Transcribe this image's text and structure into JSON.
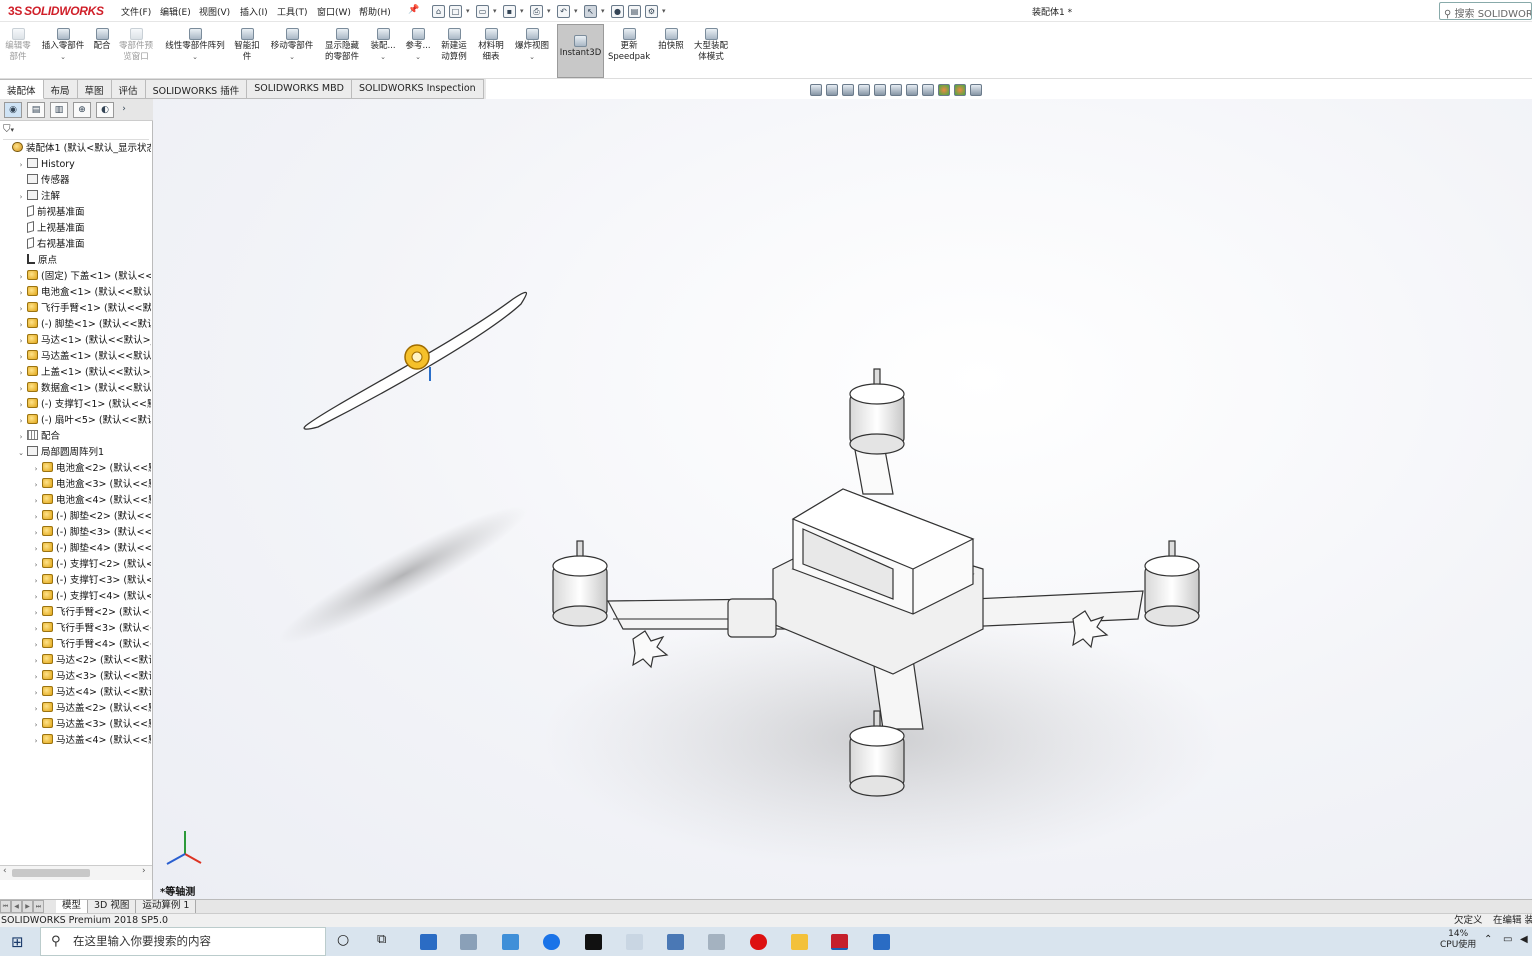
{
  "app": {
    "brand": "SOLIDWORKS",
    "doc_title": "装配体1 *",
    "search_placeholder": "搜索 SOLIDWORKS"
  },
  "menu": [
    "文件(F)",
    "编辑(E)",
    "视图(V)",
    "插入(I)",
    "工具(T)",
    "窗口(W)",
    "帮助(H)"
  ],
  "commands": [
    {
      "label": "编辑零\n部件",
      "disabled": true
    },
    {
      "label": "插入零部件",
      "dropdown": true
    },
    {
      "label": "配合"
    },
    {
      "label": "零部件预\n览窗口",
      "disabled": true
    },
    {
      "label": "线性零部件阵列",
      "dropdown": true
    },
    {
      "label": "智能扣\n件"
    },
    {
      "label": "移动零部件",
      "dropdown": true
    },
    {
      "label": "显示隐藏\n的零部件"
    },
    {
      "label": "装配...",
      "dropdown": true
    },
    {
      "label": "参考...",
      "dropdown": true
    },
    {
      "label": "新建运\n动算例"
    },
    {
      "label": "材料明\n细表"
    },
    {
      "label": "爆炸视图",
      "dropdown": true
    },
    {
      "label": "Instant3D",
      "active": true
    },
    {
      "label": "更新\nSpeedpak"
    },
    {
      "label": "拍快照"
    },
    {
      "label": "大型装配\n体模式"
    }
  ],
  "tabs": [
    "装配体",
    "布局",
    "草图",
    "评估",
    "SOLIDWORKS 插件",
    "SOLIDWORKS MBD",
    "SOLIDWORKS Inspection"
  ],
  "active_tab": "装配体",
  "tree": [
    {
      "label": "装配体1  (默认<默认_显示状态",
      "icon": "asm",
      "indent": 0,
      "arrow": ""
    },
    {
      "label": "History",
      "icon": "fold",
      "indent": 1,
      "arrow": "›"
    },
    {
      "label": "传感器",
      "icon": "fold",
      "indent": 1,
      "arrow": ""
    },
    {
      "label": "注解",
      "icon": "fold",
      "indent": 1,
      "arrow": "›"
    },
    {
      "label": "前视基准面",
      "icon": "plane",
      "indent": 1,
      "arrow": ""
    },
    {
      "label": "上视基准面",
      "icon": "plane",
      "indent": 1,
      "arrow": ""
    },
    {
      "label": "右视基准面",
      "icon": "plane",
      "indent": 1,
      "arrow": ""
    },
    {
      "label": "原点",
      "icon": "origin",
      "indent": 1,
      "arrow": ""
    },
    {
      "label": "(固定) 下盖<1> (默认<<默",
      "icon": "part",
      "indent": 1,
      "arrow": "›"
    },
    {
      "label": "电池盒<1> (默认<<默认>",
      "icon": "part",
      "indent": 1,
      "arrow": "›"
    },
    {
      "label": "飞行手臂<1> (默认<<默认",
      "icon": "part",
      "indent": 1,
      "arrow": "›"
    },
    {
      "label": "(-) 脚垫<1> (默认<<默认>",
      "icon": "part",
      "indent": 1,
      "arrow": "›"
    },
    {
      "label": "马达<1> (默认<<默认>_显",
      "icon": "part",
      "indent": 1,
      "arrow": "›"
    },
    {
      "label": "马达盖<1> (默认<<默认>",
      "icon": "part",
      "indent": 1,
      "arrow": "›"
    },
    {
      "label": "上盖<1> (默认<<默认>_显",
      "icon": "part",
      "indent": 1,
      "arrow": "›"
    },
    {
      "label": "数据盒<1> (默认<<默认>",
      "icon": "part",
      "indent": 1,
      "arrow": "›"
    },
    {
      "label": "(-) 支撑钉<1> (默认<<默认",
      "icon": "part",
      "indent": 1,
      "arrow": "›"
    },
    {
      "label": "(-) 扇叶<5> (默认<<默认>",
      "icon": "part",
      "indent": 1,
      "arrow": "›"
    },
    {
      "label": "配合",
      "icon": "mate",
      "indent": 1,
      "arrow": "›"
    },
    {
      "label": "局部圆周阵列1",
      "icon": "fold",
      "indent": 1,
      "arrow": "⌄"
    },
    {
      "label": "电池盒<2> (默认<<默认",
      "icon": "part",
      "indent": 2,
      "arrow": "›"
    },
    {
      "label": "电池盒<3> (默认<<默认",
      "icon": "part",
      "indent": 2,
      "arrow": "›"
    },
    {
      "label": "电池盒<4> (默认<<默认",
      "icon": "part",
      "indent": 2,
      "arrow": "›"
    },
    {
      "label": "(-) 脚垫<2> (默认<<默",
      "icon": "part",
      "indent": 2,
      "arrow": "›"
    },
    {
      "label": "(-) 脚垫<3> (默认<<默",
      "icon": "part",
      "indent": 2,
      "arrow": "›"
    },
    {
      "label": "(-) 脚垫<4> (默认<<默",
      "icon": "part",
      "indent": 2,
      "arrow": "›"
    },
    {
      "label": "(-) 支撑钉<2> (默认<<",
      "icon": "part",
      "indent": 2,
      "arrow": "›"
    },
    {
      "label": "(-) 支撑钉<3> (默认<<",
      "icon": "part",
      "indent": 2,
      "arrow": "›"
    },
    {
      "label": "(-) 支撑钉<4> (默认<<",
      "icon": "part",
      "indent": 2,
      "arrow": "›"
    },
    {
      "label": "飞行手臂<2> (默认<<",
      "icon": "part",
      "indent": 2,
      "arrow": "›"
    },
    {
      "label": "飞行手臂<3> (默认<<",
      "icon": "part",
      "indent": 2,
      "arrow": "›"
    },
    {
      "label": "飞行手臂<4> (默认<<",
      "icon": "part",
      "indent": 2,
      "arrow": "›"
    },
    {
      "label": "马达<2> (默认<<默认",
      "icon": "part",
      "indent": 2,
      "arrow": "›"
    },
    {
      "label": "马达<3> (默认<<默认",
      "icon": "part",
      "indent": 2,
      "arrow": "›"
    },
    {
      "label": "马达<4> (默认<<默认",
      "icon": "part",
      "indent": 2,
      "arrow": "›"
    },
    {
      "label": "马达盖<2> (默认<<默认",
      "icon": "part",
      "indent": 2,
      "arrow": "›"
    },
    {
      "label": "马达盖<3> (默认<<默认",
      "icon": "part",
      "indent": 2,
      "arrow": "›"
    },
    {
      "label": "马达盖<4> (默认<<默认",
      "icon": "part",
      "indent": 2,
      "arrow": "›"
    }
  ],
  "viewport": {
    "view_label": "*等轴测"
  },
  "bottom_tabs": [
    "模型",
    "3D 视图",
    "运动算例 1"
  ],
  "status": {
    "product": "SOLIDWORKS Premium 2018 SP5.0",
    "state": "欠定义",
    "editing": "在编辑 装"
  },
  "taskbar": {
    "search_placeholder": "在这里输入你要搜索的内容",
    "cpu_percent": "14%",
    "cpu_label": "CPU使用"
  },
  "colors": {
    "brand_red": "#d0202a",
    "taskbar": "#d9e4ee",
    "active_cmd": "#c8c8c8"
  }
}
